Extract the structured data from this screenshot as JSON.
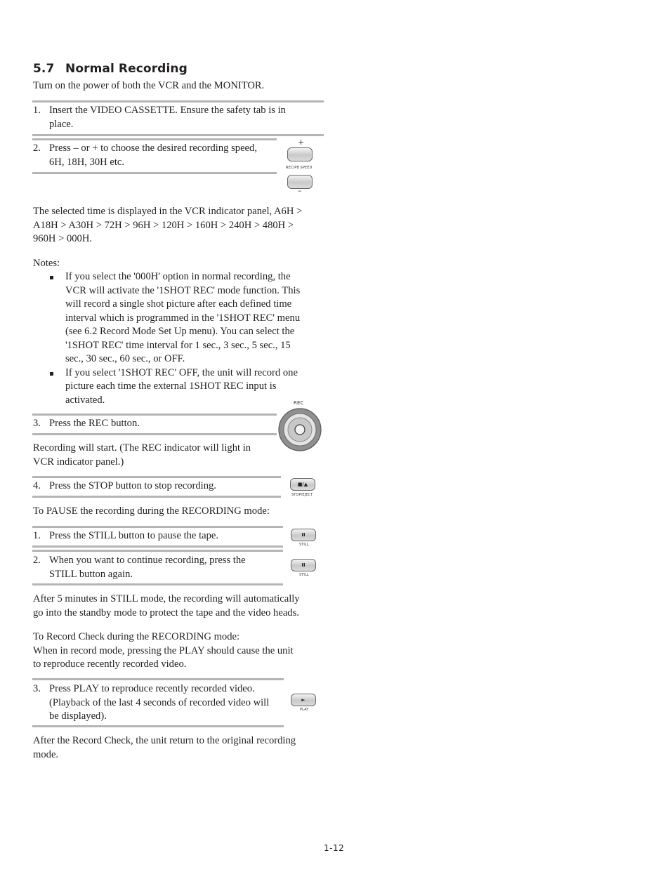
{
  "section": {
    "number": "5.7",
    "title": "Normal Recording"
  },
  "intro": "Turn on the power of both the VCR and the MONITOR.",
  "steps_a": [
    {
      "num": "1.",
      "lines": [
        "Insert the VIDEO CASSETTE. Ensure the safety tab is in",
        "place."
      ]
    },
    {
      "num": "2.",
      "lines": [
        "Press – or + to choose the desired recording speed,",
        "6H, 18H, 30H etc."
      ]
    }
  ],
  "speed_sequence": [
    "The selected time is displayed in the VCR indicator panel, A6H >",
    "A18H > A30H > 72H > 96H > 120H > 160H > 240H > 480H >",
    "960H > 000H."
  ],
  "notes": {
    "heading": "Notes:",
    "items": [
      {
        "lines": [
          "If you select the '000H' option in normal recording, the",
          "VCR will activate the '1SHOT REC' mode function. This",
          "will record a single shot picture after each defined time",
          "interval which is programmed in the '1SHOT REC' menu",
          "(see 6.2 Record Mode Set Up menu). You can select the",
          "'1SHOT REC' time interval for 1 sec., 3 sec., 5 sec., 15",
          "sec., 30 sec., 60 sec., or OFF."
        ]
      },
      {
        "lines": [
          "If you select '1SHOT REC' OFF, the unit will record one",
          "picture each time the external 1SHOT REC input is",
          "activated."
        ]
      }
    ]
  },
  "step3": {
    "num": "3.",
    "text": "Press the REC button."
  },
  "rec_start": [
    "Recording will start. (The REC indicator will light in",
    "VCR indicator panel.)"
  ],
  "step4": {
    "num": "4.",
    "text": "Press the STOP button to stop recording."
  },
  "pause_heading": "To PAUSE the recording during the RECORDING mode:",
  "pause_steps": [
    {
      "num": "1.",
      "lines": [
        "Press the STILL button to pause the tape."
      ]
    },
    {
      "num": "2.",
      "lines": [
        "When you want to continue recording, press the",
        "STILL button again."
      ]
    }
  ],
  "still_note": [
    "After 5 minutes in STILL mode, the recording will automatically",
    "go into the standby mode to protect the tape and the video heads."
  ],
  "record_check": [
    "To Record Check during the RECORDING mode:",
    "When in record mode, pressing the PLAY should cause the unit",
    "to reproduce recently recorded video."
  ],
  "play_step": {
    "num": "3.",
    "lines": [
      "Press PLAY to reproduce recently recorded video.",
      "(Playback of the last 4 seconds of recorded video will",
      "be displayed)."
    ]
  },
  "after_check": [
    "After the Record Check, the unit return to the original recording",
    "mode."
  ],
  "buttons": {
    "speed": {
      "plus": "+",
      "minus": "–",
      "caption": "REC/PB SPEED"
    },
    "rec": {
      "caption": "REC"
    },
    "stop": {
      "glyph": "■/▲",
      "caption": "STOP/EJECT"
    },
    "still": {
      "glyph": "II",
      "caption": "STILL"
    },
    "play": {
      "glyph": "►",
      "caption": "PLAY"
    }
  },
  "page_number": "1-12"
}
